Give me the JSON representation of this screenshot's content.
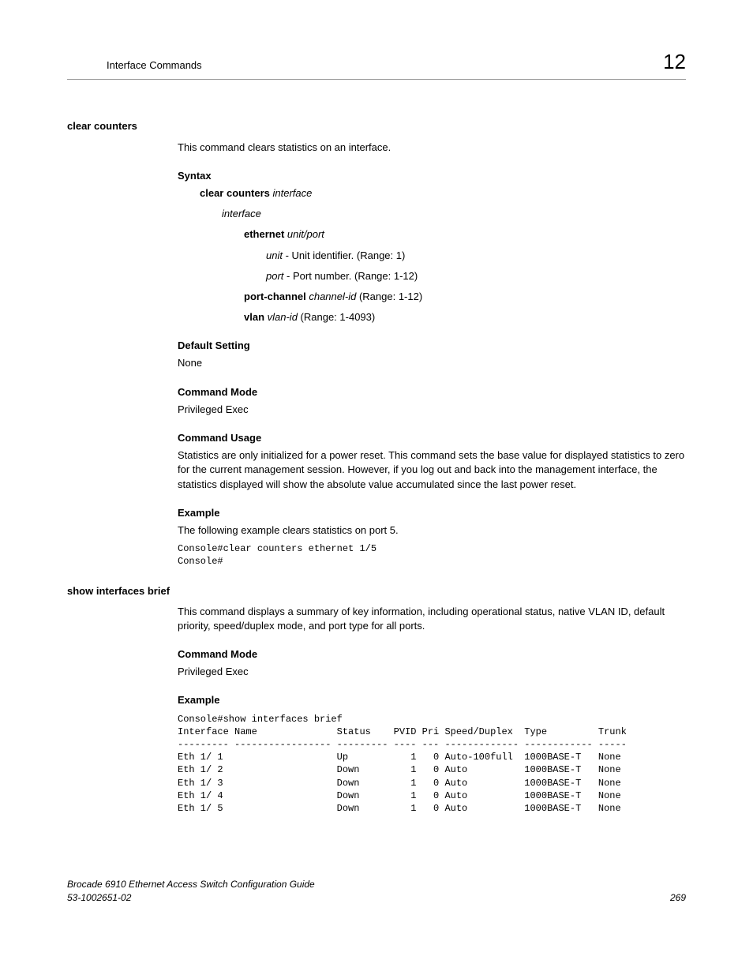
{
  "header": {
    "title": "Interface Commands",
    "chapter": "12"
  },
  "sections": [
    {
      "heading": "clear counters",
      "intro": "This command clears statistics on an interface.",
      "syntax": {
        "label": "Syntax",
        "cmd_bold": "clear counters",
        "cmd_arg": " interface",
        "interface": "interface",
        "ethernet_bold": "ethernet",
        "ethernet_arg": " unit/port",
        "unit_italic": "unit",
        "unit_desc": " - Unit identifier. (Range: 1)",
        "port_italic": "port",
        "port_desc": " - Port number. (Range: 1-12)",
        "portchannel_bold": "port-channel",
        "portchannel_arg": " channel-id",
        "portchannel_range": " (Range: 1-12)",
        "vlan_bold": "vlan",
        "vlan_arg": " vlan-id",
        "vlan_range": " (Range: 1-4093)"
      },
      "default": {
        "label": "Default Setting",
        "value": "None"
      },
      "mode": {
        "label": "Command Mode",
        "value": "Privileged Exec"
      },
      "usage": {
        "label": "Command Usage",
        "text": "Statistics are only initialized for a power reset. This command sets the base value for displayed statistics to zero for the current management session. However, if you log out and back into the management interface, the statistics displayed will show the absolute value accumulated since the last power reset."
      },
      "example": {
        "label": "Example",
        "intro": "The following example clears statistics on port 5.",
        "code": "Console#clear counters ethernet 1/5\nConsole#"
      }
    },
    {
      "heading": "show interfaces brief",
      "intro": "This command displays a summary of key information, including operational status, native VLAN ID, default priority, speed/duplex mode, and port type for all ports.",
      "mode": {
        "label": "Command Mode",
        "value": "Privileged Exec"
      },
      "example": {
        "label": "Example",
        "code": "Console#show interfaces brief\nInterface Name              Status    PVID Pri Speed/Duplex  Type         Trunk\n--------- ----------------- --------- ---- --- ------------- ------------ -----\nEth 1/ 1                    Up           1   0 Auto-100full  1000BASE-T   None\nEth 1/ 2                    Down         1   0 Auto          1000BASE-T   None\nEth 1/ 3                    Down         1   0 Auto          1000BASE-T   None\nEth 1/ 4                    Down         1   0 Auto          1000BASE-T   None\nEth 1/ 5                    Down         1   0 Auto          1000BASE-T   None"
      }
    }
  ],
  "footer": {
    "left_line1": "Brocade 6910 Ethernet Access Switch Configuration Guide",
    "left_line2": "53-1002651-02",
    "page": "269"
  }
}
